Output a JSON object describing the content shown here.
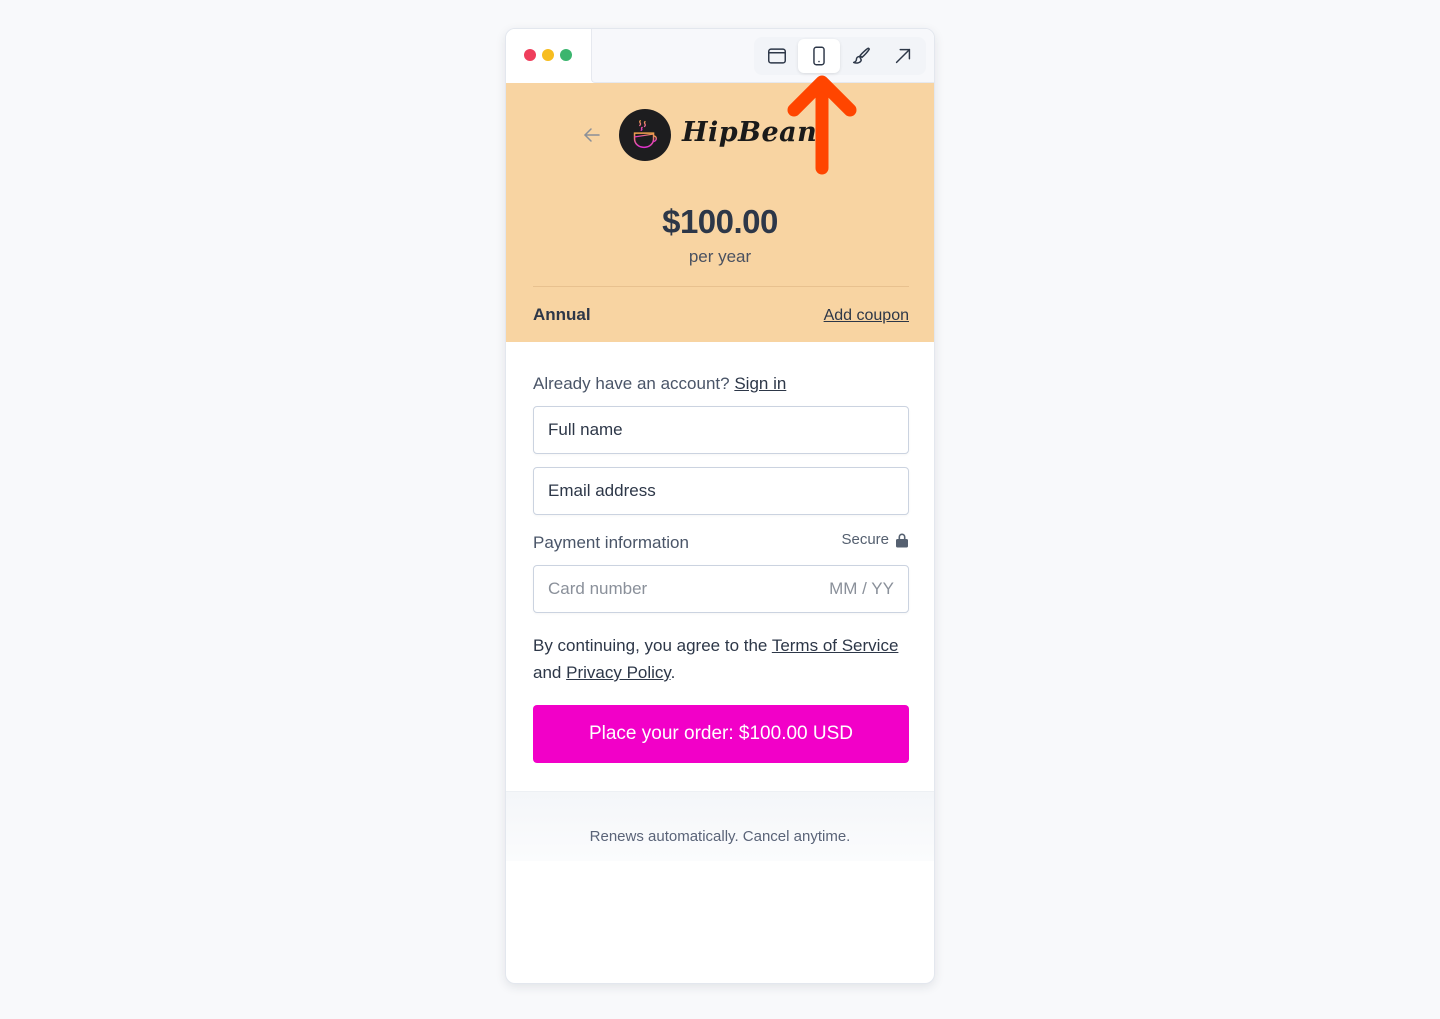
{
  "window": {
    "controls": [
      "close",
      "minimize",
      "maximize"
    ],
    "toolbar": [
      {
        "icon": "browser-window-icon",
        "label": "Desktop view",
        "active": false
      },
      {
        "icon": "mobile-phone-icon",
        "label": "Mobile view",
        "active": true
      },
      {
        "icon": "paintbrush-icon",
        "label": "Customize",
        "active": false
      },
      {
        "icon": "external-link-arrow-icon",
        "label": "Open",
        "active": false
      }
    ]
  },
  "header": {
    "back_icon": "arrow-left-icon",
    "brand": "HipBean",
    "logo_icon": "coffee-cup-icon",
    "price": "$100.00",
    "period": "per year",
    "plan": "Annual",
    "coupon_link": "Add coupon",
    "background_color": "#f8d4a2"
  },
  "form": {
    "signin_prompt": "Already have an account?",
    "signin_link": "Sign in",
    "full_name_placeholder": "Full name",
    "email_placeholder": "Email address",
    "payment_label": "Payment information",
    "secure_label": "Secure",
    "card_number_placeholder": "Card number",
    "expiry_placeholder": "MM / YY",
    "terms_prefix": "By continuing, you agree to the",
    "terms_link": "Terms of Service",
    "terms_and": "and",
    "privacy_link": "Privacy Policy",
    "terms_suffix": ".",
    "order_button": "Place your order: $100.00 USD",
    "order_button_color": "#f200c8"
  },
  "footer": {
    "note": "Renews automatically. Cancel anytime."
  },
  "annotation": {
    "type": "arrow-up",
    "color": "#ff4500",
    "points_to": "Mobile view"
  }
}
